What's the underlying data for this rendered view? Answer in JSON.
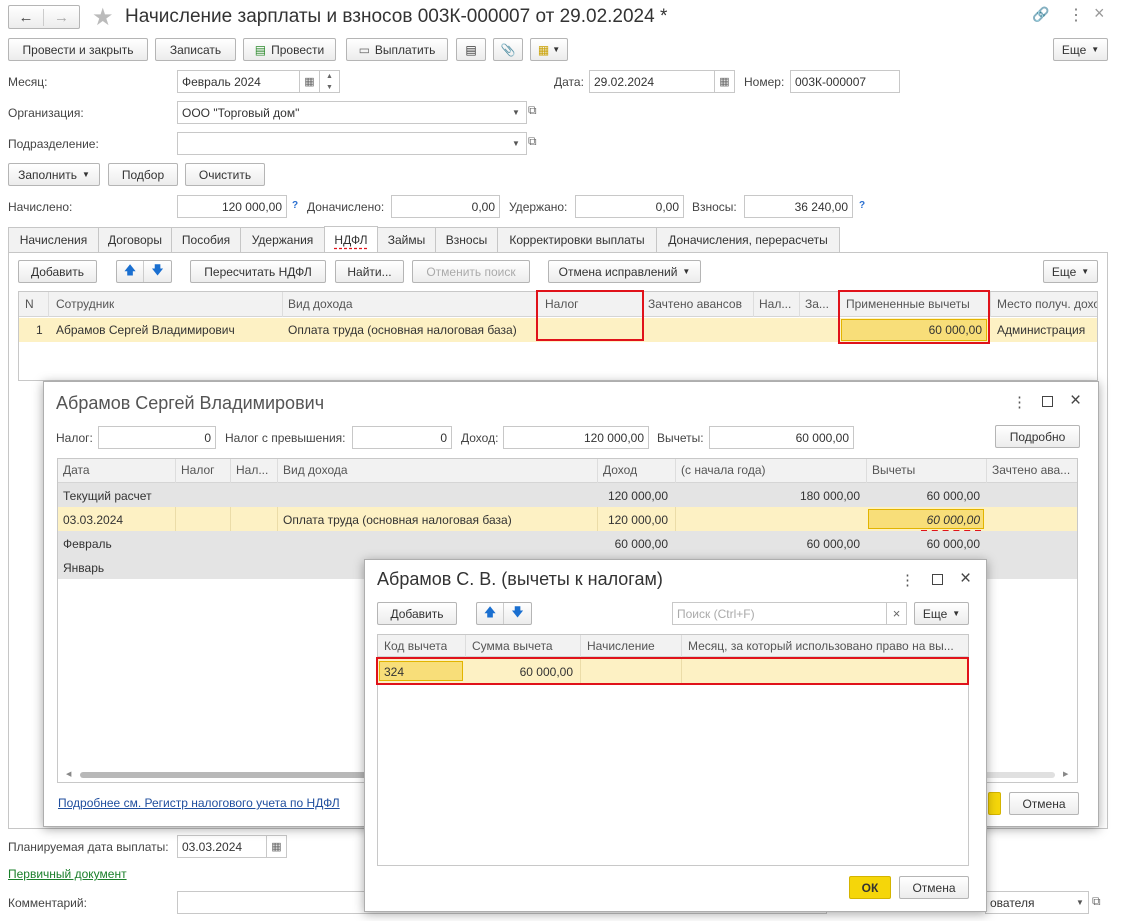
{
  "window": {
    "title": "Начисление зарплаты и взносов 003К-000007 от 29.02.2024 *"
  },
  "toolbar": {
    "post_close": "Провести и закрыть",
    "save": "Записать",
    "post": "Провести",
    "pay": "Выплатить",
    "more": "Еще"
  },
  "header": {
    "month_label": "Месяц:",
    "month_value": "Февраль 2024",
    "date_label": "Дата:",
    "date_value": "29.02.2024",
    "number_label": "Номер:",
    "number_value": "003К-000007",
    "org_label": "Организация:",
    "org_value": "ООО \"Торговый дом\"",
    "dept_label": "Подразделение:",
    "dept_value": ""
  },
  "fill_buttons": {
    "fill": "Заполнить",
    "select": "Подбор",
    "clear": "Очистить"
  },
  "totals": {
    "accrued_label": "Начислено:",
    "accrued": "120 000,00",
    "extra_label": "Доначислено:",
    "extra": "0,00",
    "withheld_label": "Удержано:",
    "withheld": "0,00",
    "contrib_label": "Взносы:",
    "contrib": "36 240,00",
    "q": "?"
  },
  "tabs": [
    "Начисления",
    "Договоры",
    "Пособия",
    "Удержания",
    "НДФЛ",
    "Займы",
    "Взносы",
    "Корректировки выплаты",
    "Доначисления, перерасчеты"
  ],
  "ndfl_toolbar": {
    "add": "Добавить",
    "recalc": "Пересчитать НДФЛ",
    "find": "Найти...",
    "cancel_search": "Отменить поиск",
    "cancel_fix": "Отмена исправлений",
    "more": "Еще"
  },
  "main_table": {
    "headers": [
      "N",
      "Сотрудник",
      "Вид дохода",
      "Налог",
      "Зачтено авансов",
      "Нал...",
      "За...",
      "Примененные вычеты",
      "Место получ. дохо"
    ],
    "row": [
      "1",
      "Абрамов Сергей Владимирович",
      "Оплата труда (основная налоговая база)",
      "",
      "",
      "",
      "",
      "60 000,00",
      "Администрация"
    ]
  },
  "footer": {
    "pay_date_label": "Планируемая дата выплаты:",
    "pay_date": "03.03.2024",
    "primary_doc": "Первичный документ",
    "comment_label": "Комментарий:",
    "responsible_tail": "ователя"
  },
  "dialog1": {
    "title": "Абрамов Сергей Владимирович",
    "tax_label": "Налог:",
    "tax": "0",
    "tax_excess_label": "Налог с превышения:",
    "tax_excess": "0",
    "income_label": "Доход:",
    "income": "120 000,00",
    "deductions_label": "Вычеты:",
    "deductions": "60 000,00",
    "details": "Подробно",
    "headers": [
      "Дата",
      "Налог",
      "Нал...",
      "Вид дохода",
      "Доход",
      "(с начала года)",
      "Вычеты",
      "Зачтено ава..."
    ],
    "rows": [
      {
        "date": "Текущий расчет",
        "kind": "",
        "income": "120 000,00",
        "ytd": "180 000,00",
        "ded": "60 000,00"
      },
      {
        "date": "03.03.2024",
        "kind": "Оплата труда (основная налоговая база)",
        "income": "120 000,00",
        "ytd": "",
        "ded": "60 000,00"
      },
      {
        "date": "Февраль",
        "kind": "",
        "income": "60 000,00",
        "ytd": "60 000,00",
        "ded": "60 000,00"
      },
      {
        "date": "Январь",
        "kind": "",
        "income": "",
        "ytd": "",
        "ded": ""
      }
    ],
    "link": "Подробнее см. Регистр налогового учета по НДФЛ",
    "cancel": "Отмена"
  },
  "dialog2": {
    "title": "Абрамов С. В. (вычеты к налогам)",
    "add": "Добавить",
    "search_placeholder": "Поиск (Ctrl+F)",
    "more": "Еще",
    "headers": [
      "Код вычета",
      "Сумма вычета",
      "Начисление",
      "Месяц, за который использовано право на вы..."
    ],
    "row": [
      "324",
      "60 000,00",
      "",
      ""
    ],
    "ok": "ОК",
    "cancel": "Отмена"
  },
  "colors": {
    "accent_yellow": "#f5d60a",
    "row_selected": "#fdf1c4",
    "group_row": "#e4e4e4",
    "red": "#e0121a",
    "link": "#1f4e9e",
    "green_link": "#1a7f2a"
  }
}
